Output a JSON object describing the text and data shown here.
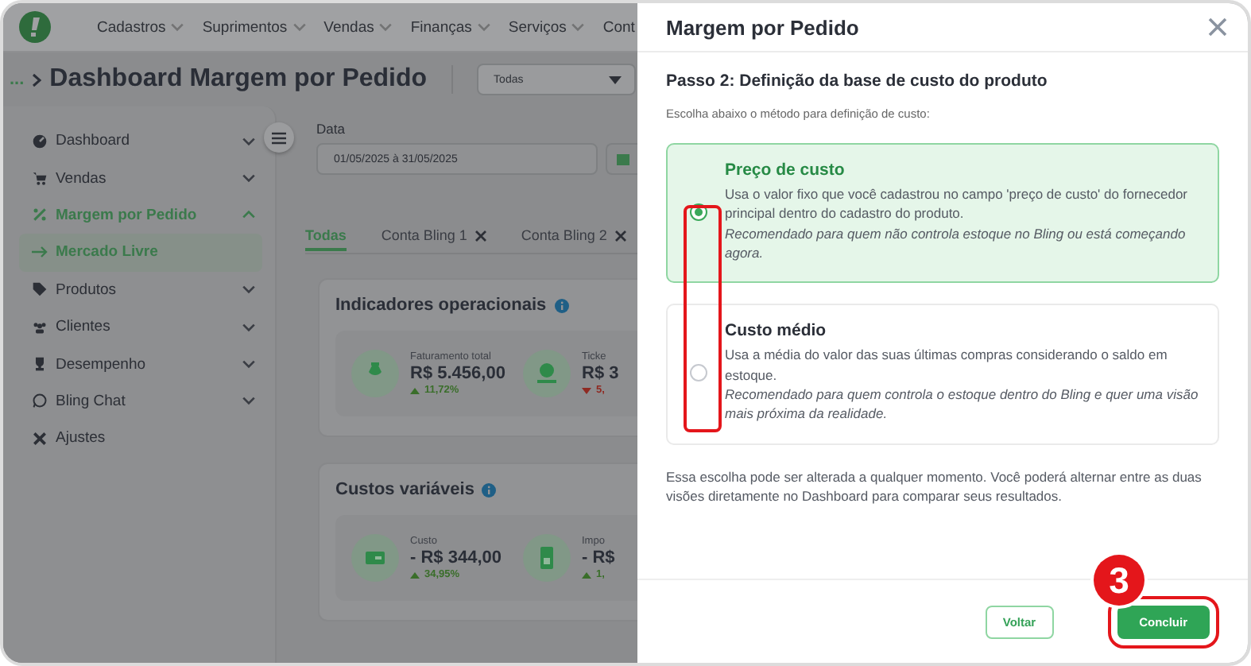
{
  "topbar": {
    "menu": [
      {
        "label": "Cadastros",
        "caret": true
      },
      {
        "label": "Suprimentos",
        "caret": true
      },
      {
        "label": "Vendas",
        "caret": true
      },
      {
        "label": "Finanças",
        "caret": true
      },
      {
        "label": "Serviços",
        "caret": true
      },
      {
        "label": "Cont",
        "caret": false
      }
    ]
  },
  "page_header": {
    "breadcrumb": "...",
    "title": "Dashboard Margem por Pedido",
    "filter": "Todas"
  },
  "sidebar": {
    "items": [
      {
        "label": "Dashboard",
        "kind": "group",
        "expanded": false,
        "selected": false
      },
      {
        "label": "Vendas",
        "kind": "group",
        "expanded": false,
        "selected": false
      },
      {
        "label": "Margem por Pedido",
        "kind": "group",
        "expanded": true,
        "selected": true,
        "children": [
          {
            "label": "Mercado Livre",
            "selected": true
          }
        ]
      },
      {
        "label": "Produtos",
        "kind": "group",
        "expanded": false,
        "selected": false
      },
      {
        "label": "Clientes",
        "kind": "group",
        "expanded": false,
        "selected": false
      },
      {
        "label": "Desempenho",
        "kind": "group",
        "expanded": false,
        "selected": false
      },
      {
        "label": "Bling Chat",
        "kind": "group",
        "expanded": false,
        "selected": false
      },
      {
        "label": "Ajustes",
        "kind": "link",
        "selected": false
      }
    ]
  },
  "date_filter": {
    "label": "Data",
    "value": "01/05/2025 à 31/05/2025"
  },
  "tabs": [
    {
      "label": "Todas",
      "selected": true,
      "closable": false
    },
    {
      "label": "Conta Bling 1",
      "selected": false,
      "closable": true
    },
    {
      "label": "Conta Bling 2",
      "selected": false,
      "closable": true
    }
  ],
  "sections": [
    {
      "title": "Indicadores operacionais",
      "metrics": [
        {
          "label": "Faturamento total",
          "value": "R$ 5.456,00",
          "change": "11,72%",
          "trend_up": true
        },
        {
          "label": "Ticke",
          "value": "R$ 3",
          "change": "5,",
          "trend_up": false
        }
      ]
    },
    {
      "title": "Custos variáveis",
      "metrics": [
        {
          "label": "Custo",
          "value": "- R$ 344,00",
          "change": "34,95%",
          "trend_up": true
        },
        {
          "label": "Impo",
          "value": "- R$",
          "change": "1,",
          "trend_up": true
        }
      ]
    }
  ],
  "drawer": {
    "title": "Margem por Pedido",
    "step_title": "Passo 2: Definição da base de custo do produto",
    "instruction": "Escolha abaixo o método para definição de custo:",
    "options": [
      {
        "title": "Preço de custo",
        "description": "Usa o valor fixo que você cadastrou no campo 'preço de custo' do fornecedor principal dentro do cadastro do produto.",
        "recommendation": "Recomendado para quem não controla estoque no Bling ou está começando agora.",
        "selected": true
      },
      {
        "title": "Custo médio",
        "description": "Usa a média do valor das suas últimas compras considerando o saldo em estoque.",
        "recommendation": "Recomendado para quem controla o estoque dentro do Bling e quer uma visão mais próxima da realidade.",
        "selected": false
      }
    ],
    "note": "Essa escolha pode ser alterada a qualquer momento. Você poderá alternar entre as duas visões diretamente no Dashboard para comparar seus resultados.",
    "buttons": [
      {
        "label": "Voltar",
        "kind": "secondary"
      },
      {
        "label": "Concluir",
        "kind": "primary"
      }
    ]
  },
  "annotation": {
    "step_number": "3"
  }
}
